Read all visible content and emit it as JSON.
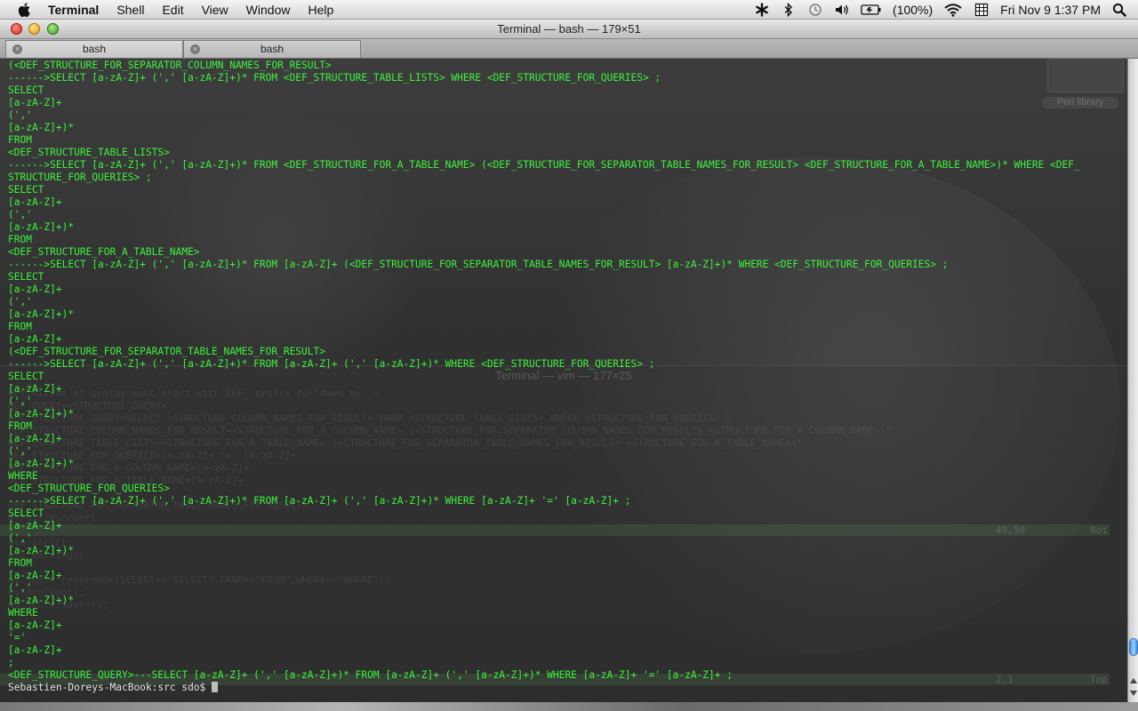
{
  "menubar": {
    "app_name": "Terminal",
    "items": [
      "Shell",
      "Edit",
      "View",
      "Window",
      "Help"
    ],
    "battery": "(100%)",
    "datetime": "Fri Nov 9  1:37 PM",
    "icons": [
      "apple-icon",
      "asterisk-icon",
      "bluetooth-icon",
      "time-machine-icon",
      "volume-icon",
      "battery-icon",
      "wifi-icon",
      "keyboard-layout-icon",
      "spotlight-icon"
    ]
  },
  "window": {
    "title": "Terminal — bash — 179×51",
    "tabs": [
      {
        "label": "bash"
      },
      {
        "label": "bash"
      }
    ]
  },
  "terminal": {
    "colors": {
      "text": "#3df23d",
      "prompt": "#e2e2e2",
      "background": "#303030"
    },
    "lines": [
      "(<DEF_STRUCTURE_FOR_SEPARATOR_COLUMN_NAMES_FOR_RESULT>",
      "------>SELECT [a-zA-Z]+ (',' [a-zA-Z]+)* FROM <DEF_STRUCTURE_TABLE_LISTS> WHERE <DEF_STRUCTURE_FOR_QUERIES> ;",
      "SELECT",
      "[a-zA-Z]+",
      "(','",
      "[a-zA-Z]+)*",
      "FROM",
      "<DEF_STRUCTURE_TABLE_LISTS>",
      "------>SELECT [a-zA-Z]+ (',' [a-zA-Z]+)* FROM <DEF_STRUCTURE_FOR_A_TABLE_NAME> (<DEF_STRUCTURE_FOR_SEPARATOR_TABLE_NAMES_FOR_RESULT> <DEF_STRUCTURE_FOR_A_TABLE_NAME>)* WHERE <DEF_",
      "STRUCTURE_FOR_QUERIES> ;",
      "SELECT",
      "[a-zA-Z]+",
      "(','",
      "[a-zA-Z]+)*",
      "FROM",
      "<DEF_STRUCTURE_FOR_A_TABLE_NAME>",
      "------>SELECT [a-zA-Z]+ (',' [a-zA-Z]+)* FROM [a-zA-Z]+ (<DEF_STRUCTURE_FOR_SEPARATOR_TABLE_NAMES_FOR_RESULT> [a-zA-Z]+)* WHERE <DEF_STRUCTURE_FOR_QUERIES> ;",
      "SELECT",
      "[a-zA-Z]+",
      "(','",
      "[a-zA-Z]+)*",
      "FROM",
      "[a-zA-Z]+",
      "(<DEF_STRUCTURE_FOR_SEPARATOR_TABLE_NAMES_FOR_RESULT>",
      "------>SELECT [a-zA-Z]+ (',' [a-zA-Z]+)* FROM [a-zA-Z]+ (',' [a-zA-Z]+)* WHERE <DEF_STRUCTURE_FOR_QUERIES> ;",
      "SELECT",
      "[a-zA-Z]+",
      "(','",
      "[a-zA-Z]+)*",
      "FROM",
      "[a-zA-Z]+",
      "(','",
      "[a-zA-Z]+)*",
      "WHERE",
      "<DEF_STRUCTURE_FOR_QUERIES>",
      "------>SELECT [a-zA-Z]+ (',' [a-zA-Z]+)* FROM [a-zA-Z]+ (',' [a-zA-Z]+)* WHERE [a-zA-Z]+ '=' [a-zA-Z]+ ;",
      "SELECT",
      "[a-zA-Z]+",
      "(','",
      "[a-zA-Z]+)*",
      "FROM",
      "[a-zA-Z]+",
      "(','",
      "[a-zA-Z]+)*",
      "WHERE",
      "[a-zA-Z]+",
      "'='",
      "[a-zA-Z]+",
      ";",
      "<DEF_STRUCTURE_QUERY>---SELECT [a-zA-Z]+ (',' [a-zA-Z]+)* FROM [a-zA-Z]+ (',' [a-zA-Z]+)* WHERE [a-zA-Z]+ '=' [a-zA-Z]+ ;"
    ],
    "prompt": "Sebastien-Doreys-MacBook:src sdo$"
  },
  "background_window": {
    "title": "Terminal — vim — 177×25",
    "lines": [
      "definition of syntax must start with DEF_ prefix followed by _+",
      "DEF_QUERY=<STRUCTURE_QUERY>",
      "DEF_STRUCTURE_QUERY=SELECT <STRUCTURE_COLUMN_NAMES_FOR_RESULT> FROM <STRUCTURE_TABLE_LISTS> WHERE <STRUCTURE_FOR_QUERIES> ;",
      "DEF_STRUCTURE_COLUMN_NAMES_FOR_RESULT=<STRUCTURE_FOR_A_COLUMN_NAME> (<STRUCTURE_FOR_SEPARATOR_COLUMN_NAMES_FOR_RESULT> <STRUCTURE_FOR_A_COLUMN_NAME>)*",
      "DEF_STRUCTURE_TABLE_LISTS=<STRUCTURE_FOR_A_TABLE_NAME> (<STRUCTURE_FOR_SEPARATOR_TABLE_NAMES_FOR_RESULT> <STRUCTURE_FOR_A_TABLE_NAME>)*",
      "DEF_STRUCTURE_FOR_QUERIES=[a-zA-Z]+ '=' [a-zA-Z]+",
      "DEF_STRUCTURE_FOR_A_COLUMN_NAME=[a-zA-Z]+",
      "DEF_STRUCTURE_FOR_A_TABLE_NAME=[a-zA-Z]+",
      "",
      "DEF_STRUCTURE_FOR_SEPARATOR_TABLE_NAMES_FOR_RESULT=','",
      "#!/usr/bin/perl",
      "",
      "use strict;",
      "use warnings;",
      "",
      "my %hash_reserved=(SELECT=>\"SELECT\",FROM=>\"FROM\",WHERE=>\"WHERE\");",
      "my @rules=();",
      "my %rule,%def=();",
      "",
      "#..."
    ],
    "status_top": {
      "position": "40,50",
      "scroll": "Bot"
    },
    "status_bottom": {
      "position": "2,1",
      "scroll": "Top"
    }
  },
  "desktop_widget": {
    "label": "Perl library"
  }
}
